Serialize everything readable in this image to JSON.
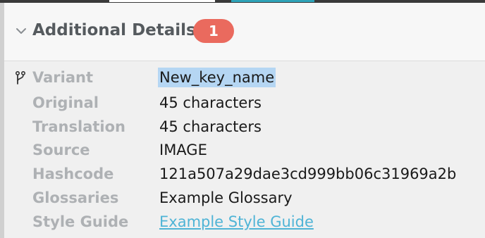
{
  "section": {
    "title": "Additional Details",
    "badge_count": "1"
  },
  "details": {
    "variant": {
      "label": "Variant",
      "value": "New_key_name"
    },
    "original": {
      "label": "Original",
      "value": "45 characters"
    },
    "translation": {
      "label": "Translation",
      "value": "45 characters"
    },
    "source": {
      "label": "Source",
      "value": "IMAGE"
    },
    "hashcode": {
      "label": "Hashcode",
      "value": "121a507a29dae3cd999bb06c31969a2b"
    },
    "glossaries": {
      "label": "Glossaries",
      "value": "Example Glossary"
    },
    "style_guide": {
      "label": "Style Guide",
      "value": "Example Style Guide"
    }
  },
  "icons": {
    "expand": "chevron-down-icon",
    "variant": "branch-icon"
  },
  "colors": {
    "badge": "#ea6a5e",
    "link": "#4fb4d6",
    "selection": "#b5d6f3"
  }
}
